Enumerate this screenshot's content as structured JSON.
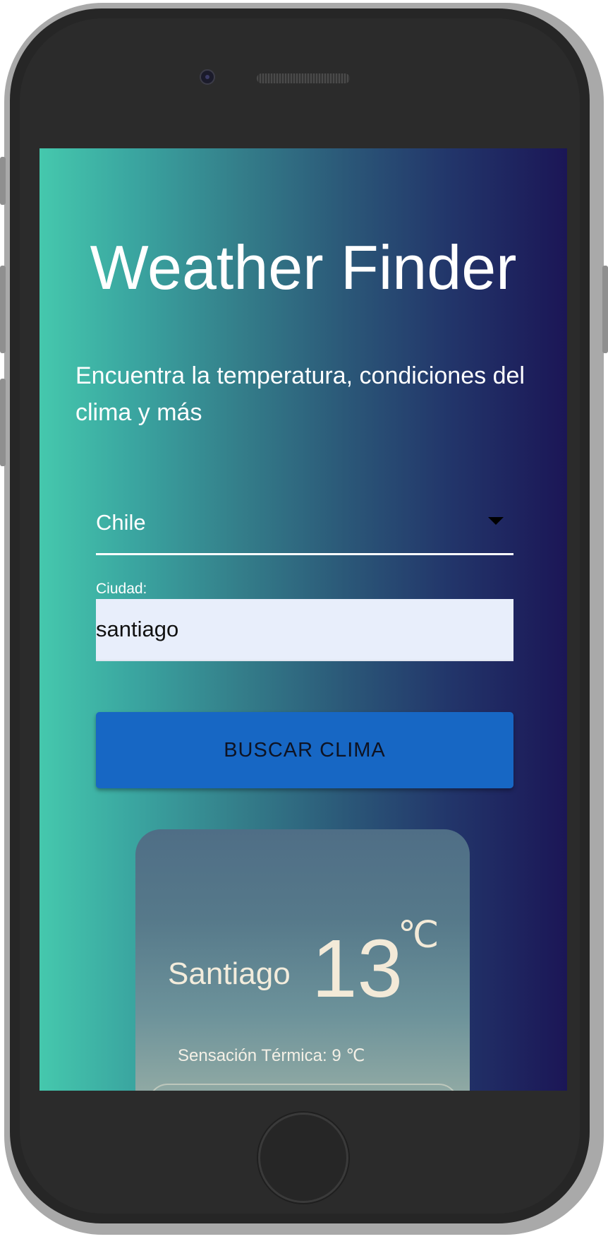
{
  "app": {
    "title": "Weather Finder",
    "subtitle": "Encuentra la temperatura, condiciones del clima y más"
  },
  "form": {
    "country_select": {
      "selected": "Chile"
    },
    "city": {
      "label": "Ciudad:",
      "value": "santiago"
    },
    "submit_label": "BUSCAR CLIMA"
  },
  "result": {
    "city": "Santiago",
    "temperature": "13",
    "unit": "℃",
    "feels_like": "Sensación Térmica: 9 ℃"
  },
  "colors": {
    "gradient_start": "#45c8ad",
    "gradient_end": "#1b1656",
    "button": "#1767c4",
    "input_bg": "#e8eefb"
  },
  "icons": {
    "select_arrow": "caret-down-icon"
  }
}
